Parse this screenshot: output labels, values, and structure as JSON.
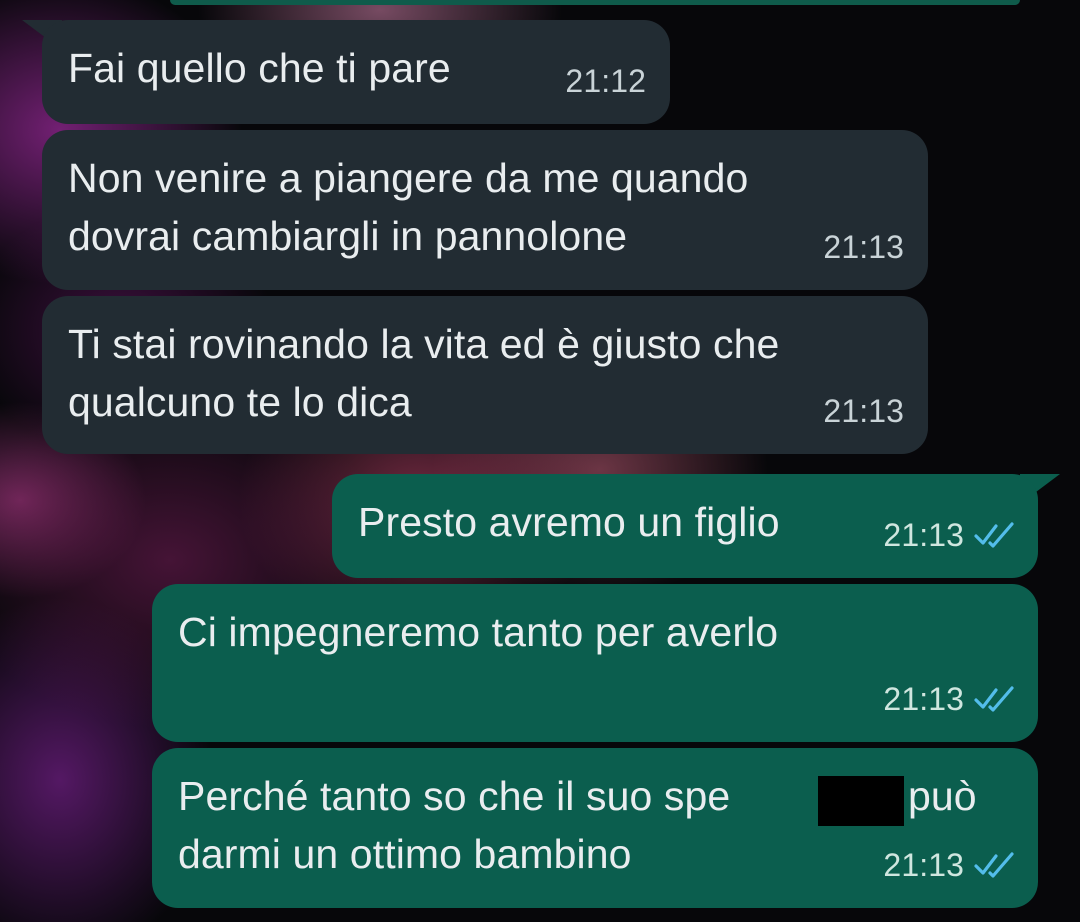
{
  "chat": {
    "messages": [
      {
        "direction": "incoming",
        "text": "Fai quello che ti pare",
        "time": "21:12"
      },
      {
        "direction": "incoming",
        "text": "Non venire a piangere da me quando\ndovrai cambiargli in pannolone",
        "time": "21:13"
      },
      {
        "direction": "incoming",
        "text": "Ti stai rovinando la vita ed è giusto che\nqualcuno te lo dica",
        "time": "21:13"
      },
      {
        "direction": "outgoing",
        "text": "Presto avremo un figlio",
        "time": "21:13",
        "status": "read"
      },
      {
        "direction": "outgoing",
        "text": "Ci impegneremo tanto per averlo",
        "time": "21:13",
        "status": "read"
      },
      {
        "direction": "outgoing",
        "text_before_redaction": "Perché tanto so che il suo spe",
        "text_after_redaction": "può",
        "text_line2": "darmi un ottimo bambino",
        "time": "21:13",
        "status": "read"
      }
    ]
  },
  "colors": {
    "incoming_bubble": "#222c33",
    "outgoing_bubble": "#0b5e4e",
    "read_ticks": "#53bdeb",
    "text": "#e9edef"
  },
  "icons": {
    "read_status": "double-check-icon"
  }
}
